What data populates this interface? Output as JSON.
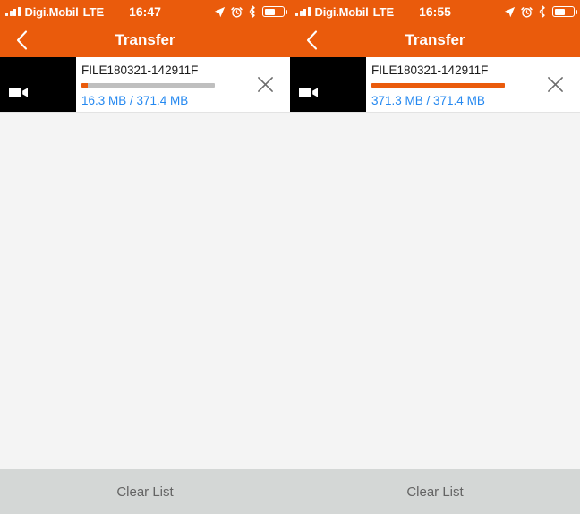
{
  "colors": {
    "accent_orange": "#ea5b0c",
    "size_blue": "#2488f0",
    "page_bg": "#f4f4f4",
    "bottom_bar_bg": "#d4d7d6",
    "progress_track": "#bfbfbf",
    "thumb_bg": "#000000",
    "clear_list_text": "#646464"
  },
  "panes": [
    {
      "status_bar": {
        "signal_icon": "signal-bars-icon",
        "carrier": "Digi.Mobil",
        "network": "LTE",
        "time": "16:47",
        "location_icon": "location-arrow-icon",
        "alarm_icon": "alarm-clock-icon",
        "bluetooth_icon": "bluetooth-icon",
        "battery_icon": "battery-icon",
        "battery_percent": 52
      },
      "nav": {
        "back_icon": "chevron-left-icon",
        "title": "Transfer"
      },
      "file": {
        "thumbnail_icon": "video-camera-icon",
        "name": "FILE180321-142911F",
        "progress_percent": 4.4,
        "size_text": "16.3 MB / 371.4 MB",
        "transferred": "16.3 MB",
        "total": "371.4 MB",
        "close_icon": "close-x-icon"
      },
      "clear_list_label": "Clear List"
    },
    {
      "status_bar": {
        "signal_icon": "signal-bars-icon",
        "carrier": "Digi.Mobil",
        "network": "LTE",
        "time": "16:55",
        "location_icon": "location-arrow-icon",
        "alarm_icon": "alarm-clock-icon",
        "bluetooth_icon": "bluetooth-icon",
        "battery_icon": "battery-icon",
        "battery_percent": 52
      },
      "nav": {
        "back_icon": "chevron-left-icon",
        "title": "Transfer"
      },
      "file": {
        "thumbnail_icon": "video-camera-icon",
        "name": "FILE180321-142911F",
        "progress_percent": 99.9,
        "size_text": "371.3 MB / 371.4 MB",
        "transferred": "371.3 MB",
        "total": "371.4 MB",
        "close_icon": "close-x-icon"
      },
      "clear_list_label": "Clear List"
    }
  ]
}
